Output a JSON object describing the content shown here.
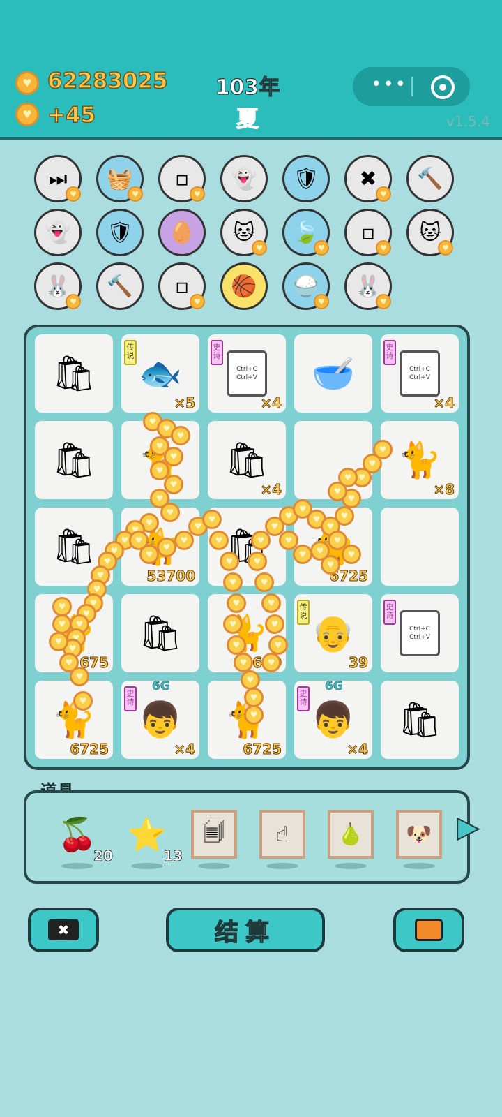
{
  "header": {
    "money": "62283025",
    "gain": "+45",
    "year": "103年",
    "season": "夏",
    "version": "v1.5.4",
    "capsule_more_icon": "more-dots-icon",
    "capsule_close_icon": "target-icon"
  },
  "colors": {
    "topbar": "#2bbcbc",
    "background": "#a9dde0",
    "coin": "#f7b63a",
    "count_text": "#f4c84a",
    "legend_tag": "#f6f08a",
    "epic_tag": "#f6c6f2"
  },
  "symbols_row": [
    {
      "icon": "skip-icon",
      "glyph": "⏭",
      "style": "plain",
      "badge": true
    },
    {
      "icon": "strawberry-basket-icon",
      "glyph": "🧺",
      "style": "blue",
      "badge": true
    },
    {
      "icon": "sugar-cubes-icon",
      "glyph": "▫",
      "style": "plain",
      "badge": true
    },
    {
      "icon": "ghost-icon",
      "glyph": "👻",
      "style": "plain",
      "badge": false
    },
    {
      "icon": "shield-wrench-icon",
      "glyph": "🛡",
      "style": "blue",
      "badge": false
    },
    {
      "icon": "delete-tag-icon",
      "glyph": "✖",
      "style": "plain",
      "badge": true
    },
    {
      "icon": "hammer-icon",
      "glyph": "🔨",
      "style": "plain",
      "badge": false
    },
    {
      "icon": "ghost-icon",
      "glyph": "👻",
      "style": "plain",
      "badge": false
    },
    {
      "icon": "shield-wrench-icon",
      "glyph": "🛡",
      "style": "blue",
      "badge": false
    },
    {
      "icon": "egg-icon",
      "glyph": "🥚",
      "style": "purple",
      "badge": false
    },
    {
      "icon": "cats-icon",
      "glyph": "🐱",
      "style": "plain",
      "badge": true
    },
    {
      "icon": "leaf-icon",
      "glyph": "🍃",
      "style": "blue",
      "badge": true
    },
    {
      "icon": "sugar-cubes-icon",
      "glyph": "▫",
      "style": "plain",
      "badge": true
    },
    {
      "icon": "cats-icon",
      "glyph": "🐱",
      "style": "plain",
      "badge": true
    },
    {
      "icon": "rabbit-icon",
      "glyph": "🐰",
      "style": "plain",
      "badge": true
    },
    {
      "icon": "hammer-icon",
      "glyph": "🔨",
      "style": "plain",
      "badge": false
    },
    {
      "icon": "sugar-cubes-icon",
      "glyph": "▫",
      "style": "plain",
      "badge": true
    },
    {
      "icon": "basketballs-icon",
      "glyph": "🏀",
      "style": "yellow",
      "badge": false
    },
    {
      "icon": "rice-bowl-icon",
      "glyph": "🍚",
      "style": "blue",
      "badge": true
    },
    {
      "icon": "rabbit-icon",
      "glyph": "🐰",
      "style": "plain",
      "badge": true
    }
  ],
  "board": [
    {
      "icon": "garbage-bag-icon",
      "glyph": "🛍",
      "count": ""
    },
    {
      "icon": "koi-fish-icon",
      "glyph": "🐟",
      "count": "×5",
      "tag": "传说",
      "tag_type": "legend"
    },
    {
      "icon": "copy-paste-card-icon",
      "card": "Ctrl+C Ctrl+V",
      "count": "×4",
      "tag": "史诗",
      "tag_type": "epic"
    },
    {
      "icon": "math-bowl-icon",
      "glyph": "🥣",
      "count": ""
    },
    {
      "icon": "copy-paste-card-icon",
      "card": "Ctrl+C Ctrl+V",
      "count": "×4",
      "tag": "史诗",
      "tag_type": "epic"
    },
    {
      "icon": "garbage-bag-icon",
      "glyph": "🛍",
      "count": ""
    },
    {
      "icon": "cat-icon",
      "glyph": "🐈",
      "count": ""
    },
    {
      "icon": "garbage-bag-icon",
      "glyph": "🛍",
      "count": "×4"
    },
    {
      "icon": "empty-cell",
      "glyph": "",
      "count": ""
    },
    {
      "icon": "cat-icon",
      "glyph": "🐈",
      "count": "×8"
    },
    {
      "icon": "garbage-bag-icon",
      "glyph": "🛍",
      "count": ""
    },
    {
      "icon": "cat-icon",
      "glyph": "🐈",
      "count": "53700"
    },
    {
      "icon": "garbage-bag-icon",
      "glyph": "🛍",
      "count": ""
    },
    {
      "icon": "cat-icon",
      "glyph": "🐈",
      "count": "6725"
    },
    {
      "icon": "empty-cell",
      "glyph": "",
      "count": ""
    },
    {
      "icon": "cat-icon",
      "glyph": "🐈",
      "count": "675"
    },
    {
      "icon": "garbage-bag-icon",
      "glyph": "🛍",
      "count": ""
    },
    {
      "icon": "cat-icon",
      "glyph": "🐈",
      "count": "690"
    },
    {
      "icon": "bald-man-icon",
      "glyph": "👴",
      "count": "39",
      "tag": "传说",
      "tag_type": "legend"
    },
    {
      "icon": "copy-paste-card-icon",
      "card": "Ctrl+C Ctrl+V",
      "count": "",
      "tag": "史诗",
      "tag_type": "epic"
    },
    {
      "icon": "cat-icon",
      "glyph": "🐈",
      "count": "6725"
    },
    {
      "icon": "boy-6g-icon",
      "glyph": "👦",
      "count": "×4",
      "tag": "史诗",
      "tag_type": "epic",
      "gen": "6G"
    },
    {
      "icon": "cat-icon",
      "glyph": "🐈",
      "count": "6725"
    },
    {
      "icon": "boy-6g-icon",
      "glyph": "👦",
      "count": "×4",
      "tag": "史诗",
      "tag_type": "epic",
      "gen": "6G"
    },
    {
      "icon": "garbage-bag-icon",
      "glyph": "🛍",
      "count": ""
    }
  ],
  "tools": {
    "label": "道具",
    "items": [
      {
        "icon": "lychee-icon",
        "glyph": "🍒",
        "count": "20",
        "framed": false
      },
      {
        "icon": "star-icon",
        "glyph": "⭐",
        "count": "13",
        "framed": false
      },
      {
        "icon": "copy-paste-card-icon",
        "glyph": "🗐",
        "count": "",
        "framed": true
      },
      {
        "icon": "pointing-finger-icon",
        "glyph": "☝",
        "count": "",
        "framed": true
      },
      {
        "icon": "pear-icon",
        "glyph": "🍐",
        "count": "",
        "framed": true
      },
      {
        "icon": "husky-icon",
        "glyph": "🐶",
        "count": "",
        "framed": true
      }
    ]
  },
  "buttons": {
    "delete_icon": "delete-tag-icon",
    "settle_label": "结算",
    "bag_icon": "briefcase-icon"
  }
}
